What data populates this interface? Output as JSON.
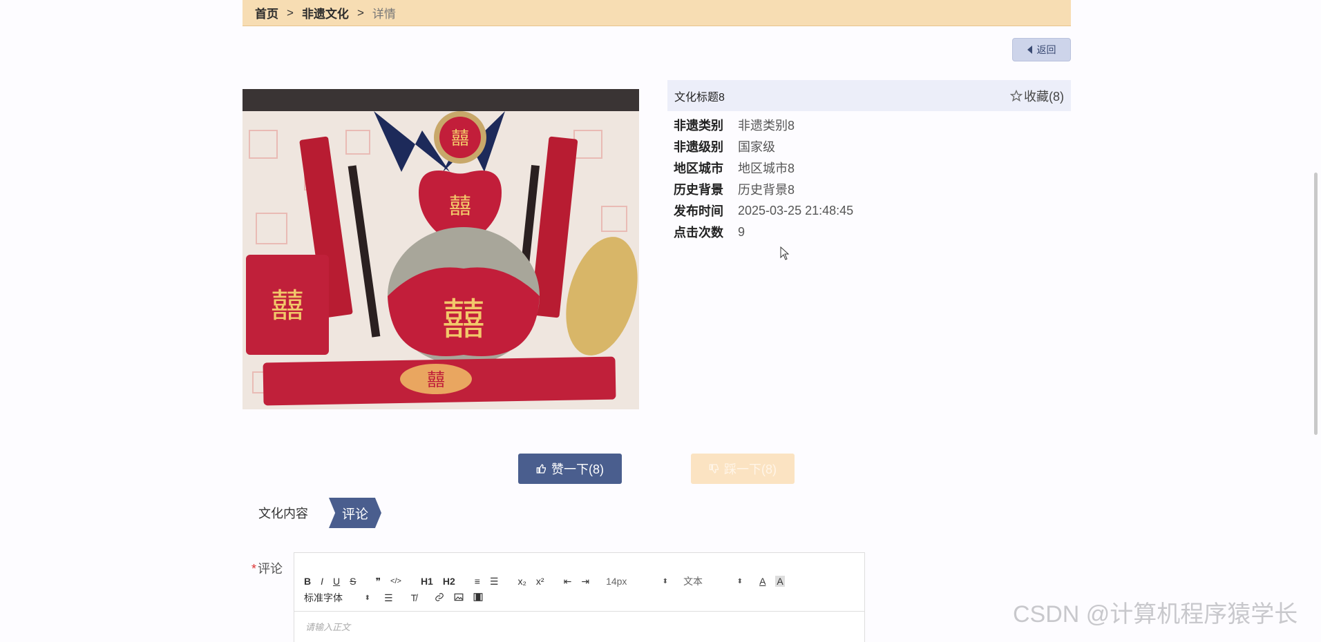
{
  "breadcrumb": {
    "home": "首页",
    "section": "非遗文化",
    "current": "详情",
    "separator": ">"
  },
  "back_button": {
    "label": "返回",
    "icon": "caret-left-icon"
  },
  "detail": {
    "title": "文化标题8",
    "favorite": {
      "label": "收藏(8)",
      "icon": "star-outline-icon"
    },
    "rows": [
      {
        "key": "非遗类别",
        "value": "非遗类别8"
      },
      {
        "key": "非遗级别",
        "value": "国家级"
      },
      {
        "key": "地区城市",
        "value": "地区城市8"
      },
      {
        "key": "历史背景",
        "value": "历史背景8"
      },
      {
        "key": "发布时间",
        "value": "2025-03-25 21:48:45"
      },
      {
        "key": "点击次数",
        "value": "9"
      }
    ]
  },
  "votes": {
    "like": {
      "label": "赞一下(8)",
      "icon": "thumbs-up-icon",
      "color": "#4a5e8e"
    },
    "dislike": {
      "label": "踩一下(8)",
      "icon": "thumbs-down-icon",
      "color": "#fbe3c2"
    }
  },
  "tabs": [
    {
      "label": "文化内容",
      "active": false
    },
    {
      "label": "评论",
      "active": true
    }
  ],
  "comment": {
    "required_mark": "*",
    "label": "评论",
    "placeholder": "请输入正文",
    "toolbar": {
      "buttons_row1": [
        "B",
        "I",
        "U",
        "S",
        "❞",
        "</>",
        "H1",
        "H2",
        "≡",
        "☰",
        "x₂",
        "x²",
        "⇤",
        "⇥"
      ],
      "font_size": "14px",
      "text_type": "文本",
      "font_family": "标准字体"
    }
  },
  "watermark": "CSDN @计算机程序猿学长"
}
